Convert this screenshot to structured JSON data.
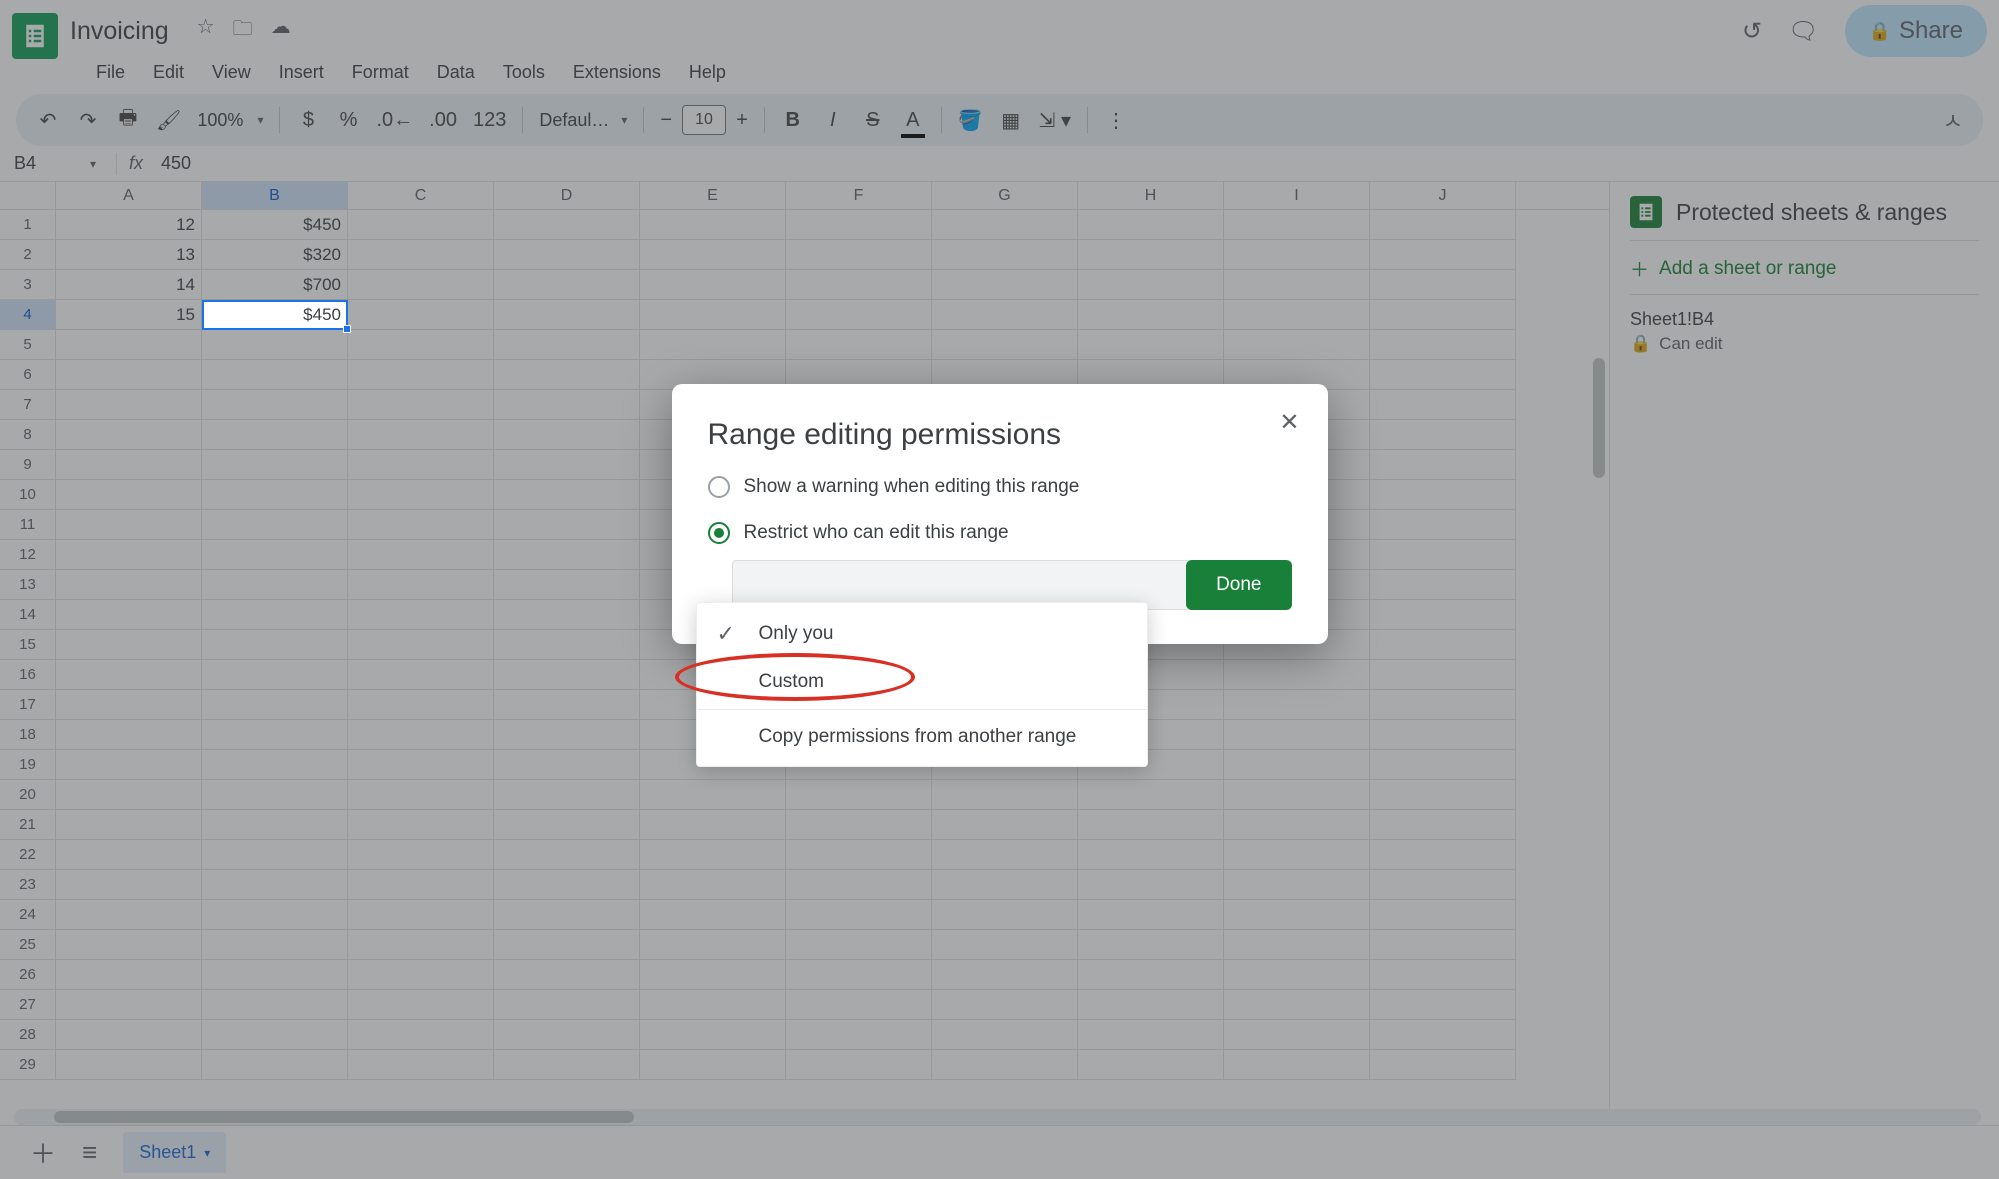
{
  "doc": {
    "title": "Invoicing"
  },
  "menubar": [
    "File",
    "Edit",
    "View",
    "Insert",
    "Format",
    "Data",
    "Tools",
    "Extensions",
    "Help"
  ],
  "share": {
    "label": "Share"
  },
  "toolbar": {
    "zoom": "100%",
    "font": "Defaul…",
    "fontSize": "10",
    "numberFormat": "123"
  },
  "namebox": {
    "ref": "B4",
    "formula": "450"
  },
  "columns": [
    "A",
    "B",
    "C",
    "D",
    "E",
    "F",
    "G",
    "H",
    "I",
    "J"
  ],
  "rows": 29,
  "selected": {
    "row": 4,
    "col": "B"
  },
  "cells": {
    "A1": "12",
    "B1": "$450",
    "A2": "13",
    "B2": "$320",
    "A3": "14",
    "B3": "$700",
    "A4": "15",
    "B4": "$450"
  },
  "sidepanel": {
    "title": "Protected sheets & ranges",
    "add": "Add a sheet or range",
    "range": {
      "name": "Sheet1!B4",
      "perm": "Can edit"
    }
  },
  "tabs": {
    "active": "Sheet1"
  },
  "dialog": {
    "title": "Range editing permissions",
    "opt1": "Show a warning when editing this range",
    "opt2": "Restrict who can edit this range",
    "dd": {
      "only_you": "Only you",
      "custom": "Custom",
      "copy": "Copy permissions from another range"
    },
    "done": "Done"
  }
}
